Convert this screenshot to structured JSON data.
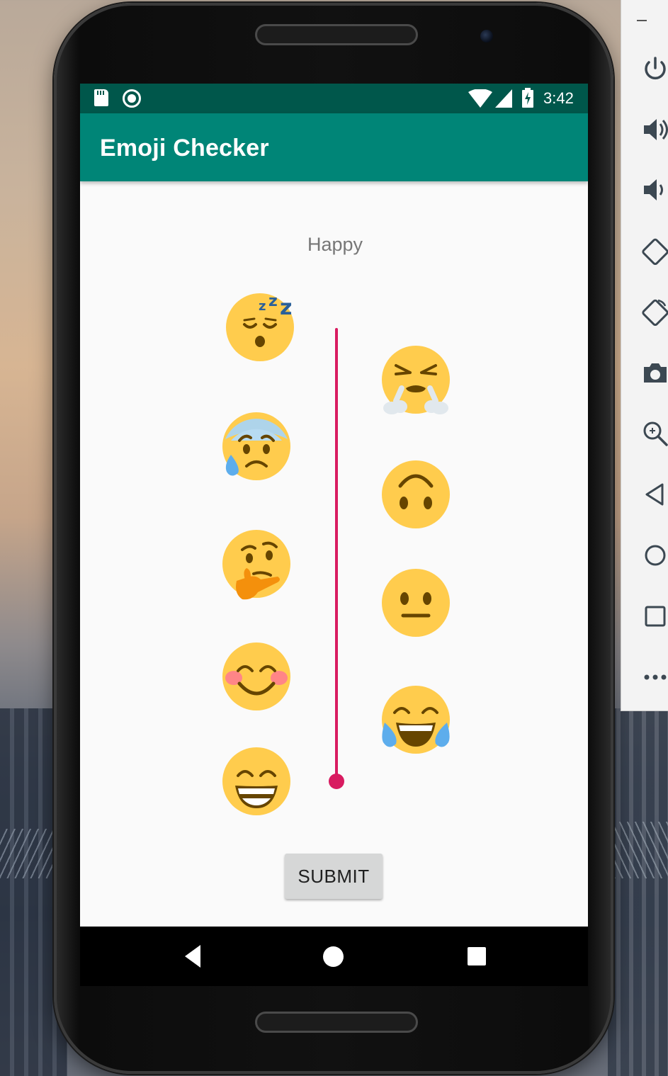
{
  "app": {
    "title": "Emoji Checker"
  },
  "status_bar": {
    "time": "3:42",
    "icons": [
      "sd-card-icon",
      "circle-icon",
      "wifi-icon",
      "signal-icon",
      "battery-charging-icon"
    ]
  },
  "main": {
    "mood_label": "Happy",
    "emojis_left": [
      "sleeping-face",
      "anxious-face-with-sweat",
      "thinking-face",
      "smiling-face-with-smiling-eyes",
      "grinning-face-with-smiling-eyes"
    ],
    "emojis_right": [
      "face-with-steam-from-nose",
      "upside-down-face",
      "neutral-face",
      "face-with-tears-of-joy"
    ],
    "slider": {
      "orientation": "vertical",
      "position": "bottom"
    },
    "submit_label": "SUBMIT"
  },
  "colors": {
    "status_bar": "#00574b",
    "app_bar": "#008577",
    "accent": "#d81b60",
    "emoji_yellow": "#ffcc4d"
  },
  "emulator_toolbar": {
    "items": [
      "minimize-icon",
      "power-icon",
      "volume-up-icon",
      "volume-down-icon",
      "rotate-left-icon",
      "rotate-right-icon",
      "camera-icon",
      "zoom-icon",
      "back-icon",
      "home-icon",
      "overview-icon",
      "more-icon"
    ]
  }
}
